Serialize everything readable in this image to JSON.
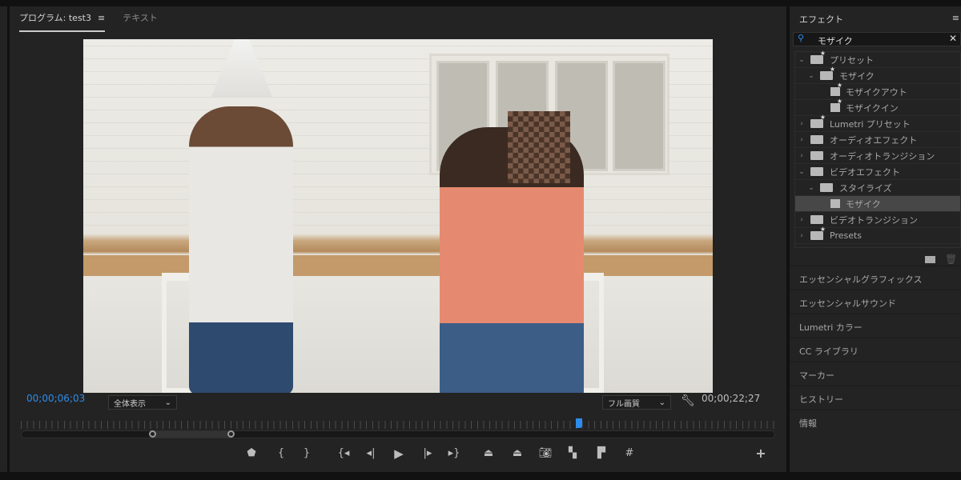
{
  "program": {
    "tabs": [
      {
        "label": "プログラム: test3",
        "active": true
      },
      {
        "label": "テキスト",
        "active": false
      }
    ],
    "menu_icon": "≡",
    "current_timecode": "00;00;06;03",
    "duration_timecode": "00;00;22;27",
    "zoom_select": "全体表示",
    "quality_select": "フル画質",
    "playhead_fraction": 0.74,
    "controls": [
      "add-marker",
      "mark-in",
      "mark-out",
      "go-to-in",
      "step-back",
      "play",
      "step-forward",
      "go-to-out",
      "lift",
      "extract",
      "export-frame",
      "insert",
      "overwrite",
      "safe-margins"
    ]
  },
  "effects": {
    "title": "エフェクト",
    "menu_icon": "≡",
    "search_value": "モザイク",
    "tree": [
      {
        "label": "プリセット",
        "depth": 0,
        "type": "preset-folder",
        "chev": "v"
      },
      {
        "label": "モザイク",
        "depth": 1,
        "type": "preset-folder",
        "chev": "v"
      },
      {
        "label": "モザイクアウト",
        "depth": 2,
        "type": "preset"
      },
      {
        "label": "モザイクイン",
        "depth": 2,
        "type": "preset"
      },
      {
        "label": "Lumetri プリセット",
        "depth": 0,
        "type": "preset-folder",
        "chev": ">"
      },
      {
        "label": "オーディオエフェクト",
        "depth": 0,
        "type": "folder",
        "chev": ">"
      },
      {
        "label": "オーディオトランジション",
        "depth": 0,
        "type": "folder",
        "chev": ">"
      },
      {
        "label": "ビデオエフェクト",
        "depth": 0,
        "type": "folder",
        "chev": "v"
      },
      {
        "label": "スタイライズ",
        "depth": 1,
        "type": "folder",
        "chev": "v"
      },
      {
        "label": "モザイク",
        "depth": 2,
        "type": "effect",
        "selected": true
      },
      {
        "label": "ビデオトランジション",
        "depth": 0,
        "type": "folder",
        "chev": ">"
      },
      {
        "label": "Presets",
        "depth": 0,
        "type": "preset-folder",
        "chev": ">"
      }
    ]
  },
  "panels": [
    "エッセンシャルグラフィックス",
    "エッセンシャルサウンド",
    "Lumetri カラー",
    "CC ライブラリ",
    "マーカー",
    "ヒストリー",
    "情報"
  ],
  "colors": {
    "accent": "#2d8ceb",
    "panel": "#232323"
  }
}
